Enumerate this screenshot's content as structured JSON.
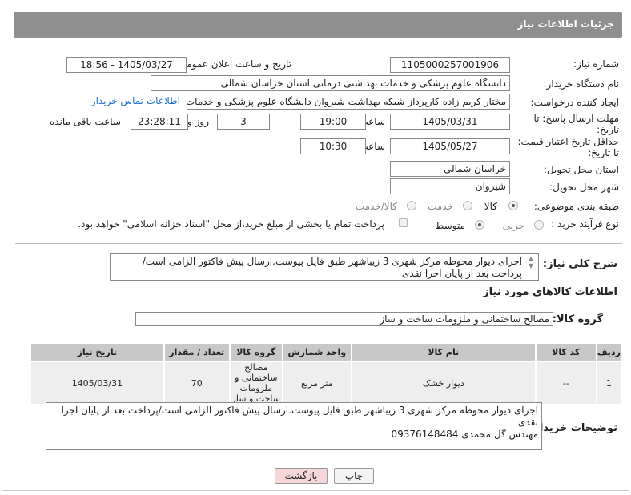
{
  "header": {
    "title": "جزئیات اطلاعات نیاز"
  },
  "fields": {
    "need_number": {
      "label": "شماره نیاز:",
      "value": "1105000257001906"
    },
    "announce_datetime": {
      "label": "تاریخ و ساعت اعلان عمومی:",
      "value": "1405/03/27 - 18:56"
    },
    "buyer_org": {
      "label": "نام دستگاه خریدار:",
      "value": "دانشگاه علوم پزشکی و خدمات بهداشتی درمانی استان خراسان شمالی"
    },
    "requester": {
      "label": "ایجاد کننده درخواست:",
      "value": "مختار کریم زاده کارپرداز شبکه بهداشت شیروان دانشگاه علوم پزشکی و خدمات",
      "contact_link": "اطلاعات تماس خریدار"
    },
    "reply_deadline": {
      "label_line1": "مهلت ارسال پاسخ: تا",
      "label_line2": "تاریخ:",
      "date": "1405/03/31",
      "time_label": "ساعت",
      "time": "19:00",
      "days": "3",
      "days_label": "روز و",
      "remaining": "23:28:11",
      "remaining_label": "ساعت باقی مانده"
    },
    "price_validity": {
      "label_line1": "حداقل تاریخ اعتبار قیمت:",
      "label_line2": "تا تاریخ:",
      "date": "1405/05/27",
      "time_label": "ساعت",
      "time": "10:30"
    },
    "delivery_province": {
      "label": "استان محل تحویل:",
      "value": "خراسان شمالی"
    },
    "delivery_city": {
      "label": "شهر محل تحویل:",
      "value": "شیروان"
    },
    "category": {
      "label": "طبقه بندی موضوعی:",
      "options": [
        "کالا",
        "خدمت",
        "کالا/خدمت"
      ],
      "selected": "کالا"
    },
    "purchase_type": {
      "label": "نوع فرآیند خرید :",
      "options": [
        "جزیی",
        "متوسط"
      ],
      "selected": "متوسط",
      "payment_note": "پرداخت تمام یا بخشی از مبلغ خرید،از محل \"اسناد خزانه اسلامی\" خواهد بود."
    }
  },
  "description": {
    "label": "شرح کلی نیاز:",
    "text": "اجرای دیوار محوطه مرکز شهری 3 زیباشهر طبق فایل پیوست.ارسال پیش فاکتور الزامی است/پرداخت بعد از پایان اجرا نقدی"
  },
  "goods_info": {
    "title": "اطلاعات کالاهای مورد نیاز"
  },
  "goods_group": {
    "label": "گروه کالا:",
    "value": "مصالح ساختمانی و ملزومات ساخت و ساز"
  },
  "table": {
    "headers": [
      "ردیف",
      "کد کالا",
      "نام کالا",
      "واحد شمارش",
      "گروه کالا",
      "تعداد / مقدار",
      "تاریخ نیاز"
    ],
    "rows": [
      [
        "1",
        "--",
        "دیوار خشک",
        "متر مربع",
        "مصالح ساختمانی و ملزومات ساخت و ساز",
        "70",
        "1405/03/31"
      ]
    ]
  },
  "buyer_notes": {
    "label": "توضیحات خریدار:",
    "line1": "اجرای دیوار محوطه مرکز شهری 3 زیباشهر طبق فایل پیوست.ارسال پیش فاکتور الزامی است/پرداخت بعد از پایان اجرا نقدی",
    "line2": "مهندس گل محمدی 09376148484"
  },
  "buttons": {
    "print": "چاپ",
    "back": "بازگشت"
  },
  "colors": {
    "header_bg": "#8f8f8f",
    "link": "#1a6fc9",
    "back_button_bg": "#f6d6d6"
  }
}
